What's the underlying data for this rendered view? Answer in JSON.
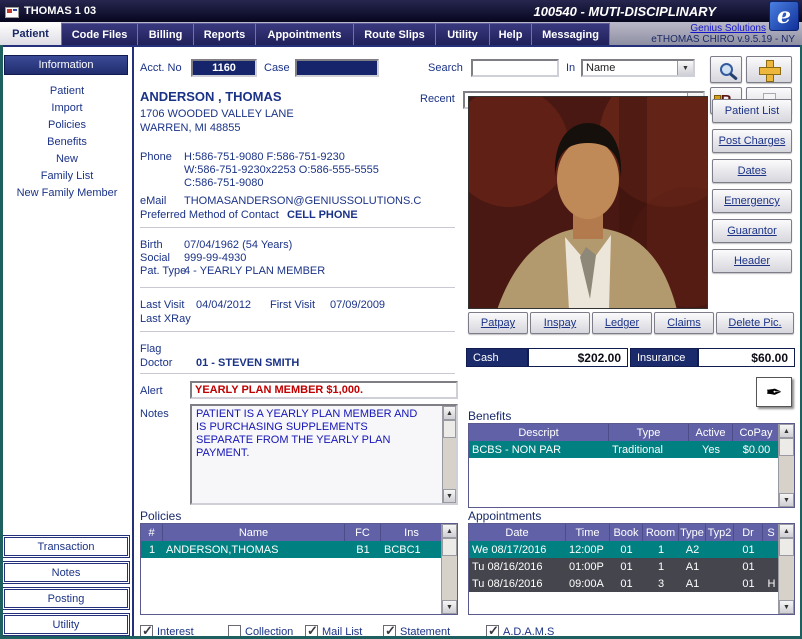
{
  "titlebar": {
    "app_label": "THOMAS 1 03",
    "title": "100540 - MUTI-DISCIPLINARY"
  },
  "header": {
    "link": "Genius Solutions",
    "version": "eTHOMAS CHIRO v.9.5.19 - NY",
    "logo_letter": "e"
  },
  "tabs": [
    "Patient",
    "Code Files",
    "Billing",
    "Reports",
    "Appointments",
    "Route Slips",
    "Utility",
    "Help",
    "Messaging"
  ],
  "sidebar": {
    "items": [
      "Information",
      "Patient",
      "Import",
      "Policies",
      "Benefits",
      "New",
      "Family List",
      "New Family Member"
    ],
    "buttons": [
      "Transaction",
      "Notes",
      "Posting",
      "Utility"
    ]
  },
  "account": {
    "acct_label": "Acct. No",
    "acct_no": "1160",
    "case_label": "Case",
    "case_value": ""
  },
  "search": {
    "search_label": "Search",
    "search_value": "",
    "in_label": "In",
    "in_value": "Name",
    "recent_label": "Recent",
    "recent_value": ""
  },
  "patient": {
    "name": "ANDERSON , THOMAS",
    "address_line1": "1706 WOODED VALLEY LANE",
    "address_line2": "WARREN, MI 48855",
    "phone_label": "Phone",
    "phone_line1": "H:586-751-9080 F:586-751-9230",
    "phone_line2": "W:586-751-9230x2253 O:586-555-5555",
    "phone_line3": "C:586-751-9080",
    "email_label": "eMail",
    "email": "THOMASANDERSON@GENIUSSOLUTIONS.C",
    "preferred_label": "Preferred Method of Contact",
    "preferred_value": "CELL PHONE",
    "birth_label": "Birth",
    "birth": "07/04/1962 (54 Years)",
    "social_label": "Social",
    "social": "999-99-4930",
    "pat_type_label": "Pat. Type",
    "pat_type": "4 - YEARLY PLAN MEMBER",
    "last_visit_label": "Last Visit",
    "last_visit": "04/04/2012",
    "first_visit_label": "First Visit",
    "first_visit": "07/09/2009",
    "last_xray_label": "Last XRay",
    "last_xray": "",
    "flag_label": "Flag",
    "flag": "",
    "doctor_label": "Doctor",
    "doctor": "01 - STEVEN SMITH",
    "alert_label": "Alert",
    "alert": "YEARLY PLAN MEMBER $1,000.",
    "notes_label": "Notes",
    "notes_lines": [
      "PATIENT IS A YEARLY PLAN MEMBER AND",
      "IS PURCHASING SUPPLEMENTS",
      "SEPARATE FROM THE YEARLY PLAN",
      "PAYMENT."
    ]
  },
  "action_buttons": [
    "Patient List",
    "Post Charges",
    "Dates",
    "Emergency",
    "Guarantor",
    "Header"
  ],
  "photo_buttons": [
    "Patpay",
    "Inspay",
    "Ledger",
    "Claims",
    "Delete Pic."
  ],
  "balances": {
    "cash_label": "Cash",
    "cash_value": "$202.00",
    "insurance_label": "Insurance",
    "insurance_value": "$60.00"
  },
  "benefits": {
    "title": "Benefits",
    "headers": [
      "Descript",
      "Type",
      "Active",
      "CoPay"
    ],
    "rows": [
      [
        "BCBS - NON PAR",
        "Traditional",
        "Yes",
        "$0.00"
      ]
    ]
  },
  "policies": {
    "title": "Policies",
    "headers": [
      "#",
      "Name",
      "FC",
      "Ins"
    ],
    "rows": [
      [
        "1",
        "ANDERSON,THOMAS",
        "B1",
        "BCBC1"
      ]
    ]
  },
  "appointments": {
    "title": "Appointments",
    "headers": [
      "Date",
      "Time",
      "Book",
      "Room",
      "Type",
      "Typ2",
      "Dr",
      "S"
    ],
    "rows": [
      [
        "We 08/17/2016",
        "12:00P",
        "01",
        "1",
        "A2",
        "",
        "01",
        ""
      ],
      [
        "Tu 08/16/2016",
        "01:00P",
        "01",
        "1",
        "A1",
        "",
        "01",
        ""
      ],
      [
        "Tu 08/16/2016",
        "09:00A",
        "01",
        "3",
        "A1",
        "",
        "01",
        "H"
      ]
    ]
  },
  "footer": {
    "checkboxes": [
      {
        "label": "Interest",
        "checked": true
      },
      {
        "label": "Collection",
        "checked": false
      },
      {
        "label": "Mail List",
        "checked": true
      },
      {
        "label": "Statement",
        "checked": true
      },
      {
        "label": "A.D.A.M.S",
        "checked": true
      }
    ]
  },
  "icons": {
    "scroll_up": "▲",
    "scroll_down": "▼",
    "combo_arrow": "▼",
    "pencil": "✒",
    "ri_letter": "R"
  },
  "colors": {
    "navy": "#1b3387",
    "header_purple": "#6161a8",
    "selected_teal": "#008080",
    "row_dark": "#45454e",
    "alert_red": "#c00000",
    "notes_blue": "#1414b8"
  }
}
